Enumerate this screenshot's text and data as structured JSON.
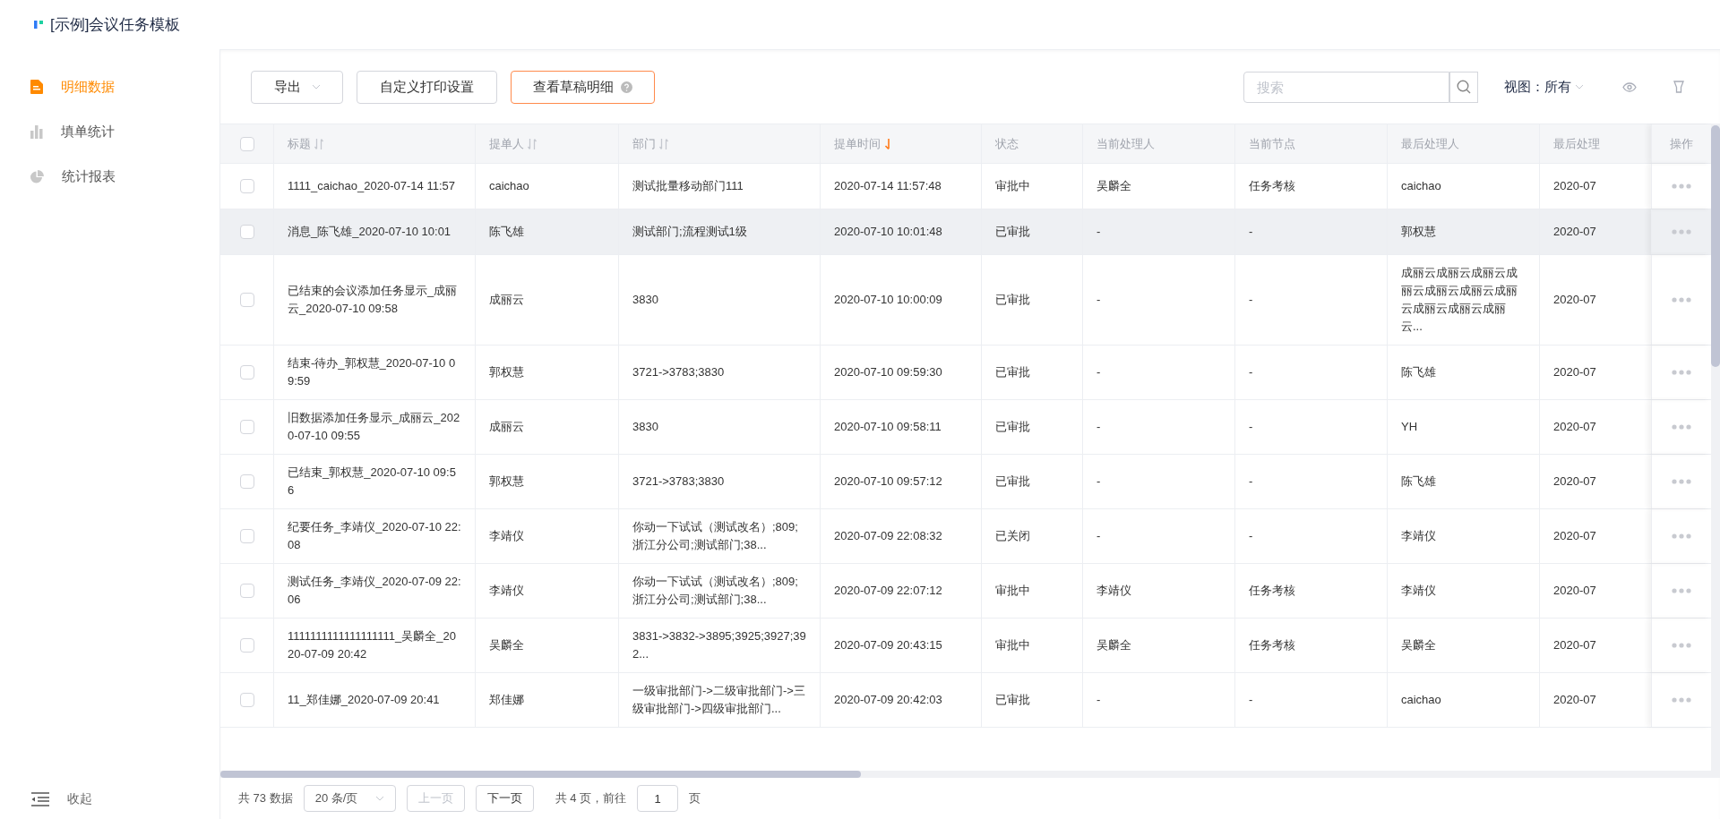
{
  "app": {
    "title": "[示例]会议任务模板"
  },
  "sidebar": {
    "items": [
      {
        "label": "明细数据",
        "kind": "doc",
        "selected": true
      },
      {
        "label": "填单统计",
        "kind": "bars",
        "selected": false
      },
      {
        "label": "统计报表",
        "kind": "pie",
        "selected": false
      }
    ],
    "collapse": "收起"
  },
  "toolbar": {
    "export": "导出",
    "print": "自定义打印设置",
    "drafts": "查看草稿明细",
    "search": {
      "placeholder": "搜索"
    },
    "view_label": "视图：",
    "view_value": "所有"
  },
  "table": {
    "all_checked": false,
    "columns": [
      {
        "label": "标题",
        "sortable": true,
        "sorted": false
      },
      {
        "label": "提单人",
        "sortable": true,
        "sorted": false
      },
      {
        "label": "部门",
        "sortable": true,
        "sorted": false
      },
      {
        "label": "提单时间",
        "sortable": true,
        "sorted": true
      },
      {
        "label": "状态",
        "sortable": false,
        "sorted": false
      },
      {
        "label": "当前处理人",
        "sortable": false,
        "sorted": false
      },
      {
        "label": "当前节点",
        "sortable": false,
        "sorted": false
      },
      {
        "label": "最后处理人",
        "sortable": false,
        "sorted": false
      },
      {
        "label": "最后处理",
        "sortable": false,
        "sorted": false
      },
      {
        "label": "操作",
        "sortable": false,
        "sorted": false
      }
    ],
    "rows": [
      {
        "checked": false,
        "hovered": false,
        "cells": [
          "1111_caichao_2020-07-14 11:57",
          "caichao",
          "测试批量移动部门111",
          "2020-07-14 11:57:48",
          "审批中",
          "吴麟全",
          "任务考核",
          "caichao",
          "2020-07"
        ]
      },
      {
        "checked": false,
        "hovered": true,
        "cells": [
          "消息_陈飞雄_2020-07-10 10:01",
          "陈飞雄",
          "测试部门;流程测试1级",
          "2020-07-10 10:01:48",
          "已审批",
          "-",
          "-",
          "郭权慧",
          "2020-07"
        ]
      },
      {
        "checked": false,
        "hovered": false,
        "cells": [
          "已结束的会议添加任务显示_成丽云_2020-07-10 09:58",
          "成丽云",
          "3830",
          "2020-07-10 10:00:09",
          "已审批",
          "-",
          "-",
          "成丽云成丽云成丽云成丽云成丽云成丽云成丽云成丽云成丽云成丽云...",
          "2020-07"
        ]
      },
      {
        "checked": false,
        "hovered": false,
        "cells": [
          "结束-待办_郭权慧_2020-07-10 09:59",
          "郭权慧",
          "3721->3783;3830",
          "2020-07-10 09:59:30",
          "已审批",
          "-",
          "-",
          "陈飞雄",
          "2020-07"
        ]
      },
      {
        "checked": false,
        "hovered": false,
        "cells": [
          "旧数据添加任务显示_成丽云_2020-07-10 09:55",
          "成丽云",
          "3830",
          "2020-07-10 09:58:11",
          "已审批",
          "-",
          "-",
          "YH",
          "2020-07"
        ]
      },
      {
        "checked": false,
        "hovered": false,
        "cells": [
          "已结束_郭权慧_2020-07-10 09:56",
          "郭权慧",
          "3721->3783;3830",
          "2020-07-10 09:57:12",
          "已审批",
          "-",
          "-",
          "陈飞雄",
          "2020-07"
        ]
      },
      {
        "checked": false,
        "hovered": false,
        "cells": [
          "纪要任务_李靖仪_2020-07-10 22:08",
          "李靖仪",
          "你动一下试试（测试改名）;809;浙江分公司;测试部门;38...",
          "2020-07-09 22:08:32",
          "已关闭",
          "-",
          "-",
          "李靖仪",
          "2020-07"
        ]
      },
      {
        "checked": false,
        "hovered": false,
        "cells": [
          "测试任务_李靖仪_2020-07-09 22:06",
          "李靖仪",
          "你动一下试试（测试改名）;809;浙江分公司;测试部门;38...",
          "2020-07-09 22:07:12",
          "审批中",
          "李靖仪",
          "任务考核",
          "李靖仪",
          "2020-07"
        ]
      },
      {
        "checked": false,
        "hovered": false,
        "cells": [
          "1111111111111111111_吴麟全_2020-07-09 20:42",
          "吴麟全",
          "3831->3832->3895;3925;3927;392...",
          "2020-07-09 20:43:15",
          "审批中",
          "吴麟全",
          "任务考核",
          "吴麟全",
          "2020-07"
        ]
      },
      {
        "checked": false,
        "hovered": false,
        "cells": [
          "11_郑佳娜_2020-07-09 20:41",
          "郑佳娜",
          "一级审批部门->二级审批部门->三级审批部门->四级审批部门...",
          "2020-07-09 20:42:03",
          "已审批",
          "-",
          "-",
          "caichao",
          "2020-07"
        ]
      }
    ]
  },
  "pagination": {
    "total": "共 73 数据",
    "page_size": "20 条/页",
    "prev": {
      "label": "上一页",
      "disabled": true
    },
    "next": {
      "label": "下一页",
      "disabled": false
    },
    "pages": "共 4 页，前往",
    "page": "1",
    "page_suffix": "页"
  }
}
